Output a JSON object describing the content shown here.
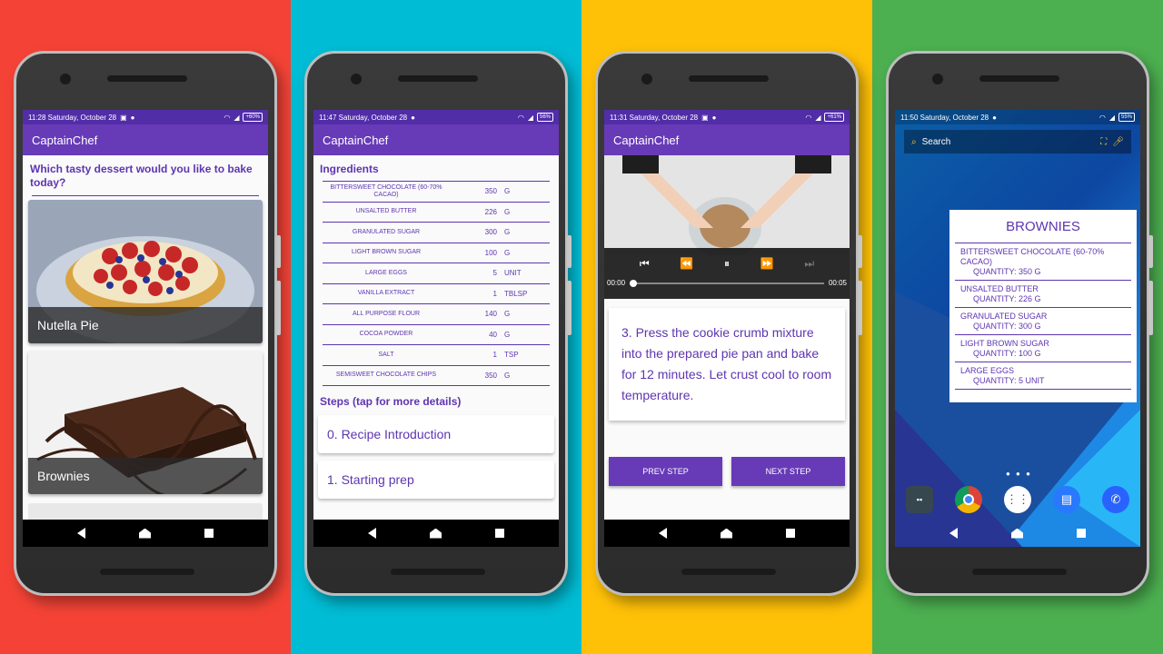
{
  "screen1": {
    "status_time": "11:28 Saturday, October 28",
    "battery": "+60%",
    "app_title": "CaptainChef",
    "question": "Which tasty dessert would you like to bake today?",
    "cards": [
      {
        "label": "Nutella Pie"
      },
      {
        "label": "Brownies"
      }
    ]
  },
  "screen2": {
    "status_time": "11:47 Saturday, October 28",
    "battery": "56%",
    "app_title": "CaptainChef",
    "ingredients_title": "Ingredients",
    "ingredients": [
      {
        "name": "BITTERSWEET CHOCOLATE (60-70% CACAO)",
        "qty": "350",
        "unit": "G"
      },
      {
        "name": "UNSALTED BUTTER",
        "qty": "226",
        "unit": "G"
      },
      {
        "name": "GRANULATED SUGAR",
        "qty": "300",
        "unit": "G"
      },
      {
        "name": "LIGHT BROWN SUGAR",
        "qty": "100",
        "unit": "G"
      },
      {
        "name": "LARGE EGGS",
        "qty": "5",
        "unit": "UNIT"
      },
      {
        "name": "VANILLA EXTRACT",
        "qty": "1",
        "unit": "TBLSP"
      },
      {
        "name": "ALL PURPOSE FLOUR",
        "qty": "140",
        "unit": "G"
      },
      {
        "name": "COCOA POWDER",
        "qty": "40",
        "unit": "G"
      },
      {
        "name": "SALT",
        "qty": "1",
        "unit": "TSP"
      },
      {
        "name": "SEMISWEET CHOCOLATE CHIPS",
        "qty": "350",
        "unit": "G"
      }
    ],
    "steps_title": "Steps (tap for more details)",
    "steps": [
      {
        "label": "0. Recipe Introduction"
      },
      {
        "label": "1. Starting prep"
      }
    ]
  },
  "screen3": {
    "status_time": "11:31 Saturday, October 28",
    "battery": "+61%",
    "app_title": "CaptainChef",
    "time_current": "00:00",
    "time_total": "00:05",
    "step_text": "3. Press the cookie crumb mixture into the prepared pie pan and bake for 12 minutes. Let crust cool to room temperature.",
    "prev_label": "PREV STEP",
    "next_label": "NEXT STEP"
  },
  "screen4": {
    "status_time": "11:50 Saturday, October 28",
    "battery": "55%",
    "search_label": "Search",
    "widget_title": "BROWNIES",
    "widget_items": [
      {
        "name": "BITTERSWEET CHOCOLATE (60-70% CACAO)",
        "qty": "QUANTITY: 350 G"
      },
      {
        "name": "UNSALTED BUTTER",
        "qty": "QUANTITY: 226 G"
      },
      {
        "name": "GRANULATED SUGAR",
        "qty": "QUANTITY: 300 G"
      },
      {
        "name": "LIGHT BROWN SUGAR",
        "qty": "QUANTITY: 100 G"
      },
      {
        "name": "LARGE EGGS",
        "qty": "QUANTITY: 5 UNIT"
      }
    ]
  },
  "colors": {
    "primary": "#673ab7",
    "primary_dark": "#512da8",
    "accent_text": "#5e35b1"
  }
}
